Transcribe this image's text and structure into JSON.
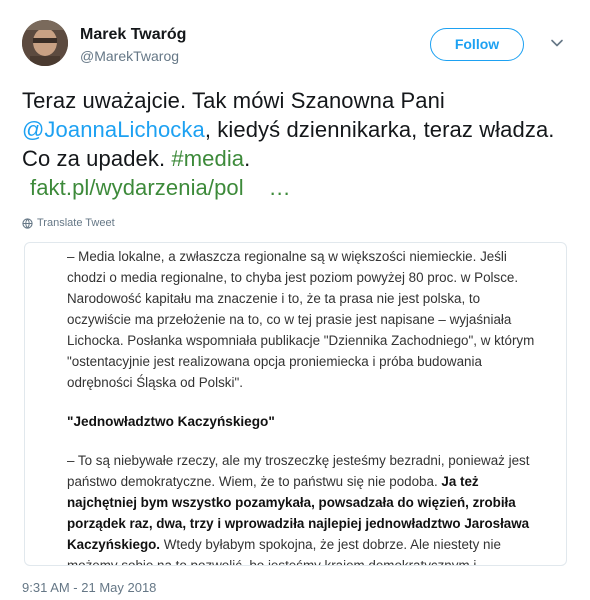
{
  "author": {
    "name": "Marek Twaróg",
    "handle": "@MarekTwarog"
  },
  "actions": {
    "follow_label": "Follow"
  },
  "tweet": {
    "text_part1": "Teraz uważajcie. Tak mówi Szanowna Pani",
    "mention": "@JoannaLichocka",
    "text_part2": ", kiedyś dziennikarka, teraz władza. Co za upadek. ",
    "hashtag": "#media",
    "text_part3": ".",
    "link": "fakt.pl/wydarzenia/pol",
    "ellipsis": "…"
  },
  "translate_label": "Translate Tweet",
  "card": {
    "paragraph1": "– Media lokalne, a zwłaszcza regionalne są w większości niemieckie. Jeśli chodzi o media regionalne, to chyba jest poziom powyżej 80 proc. w Polsce. Narodowość kapitału ma znaczenie i to, że ta prasa nie jest polska, to oczywiście ma przełożenie na to, co w tej prasie jest napisane – wyjaśniała Lichocka. Posłanka wspomniała publikacje \"Dziennika Zachodniego\", w którym \"ostentacyjnie jest realizowana opcja proniemiecka i próba budowania odrębności Śląska od Polski\".",
    "heading": "\"Jednowładztwo Kaczyńskiego\"",
    "paragraph2_start": "– To są niebywałe rzeczy, ale my troszeczkę jesteśmy bezradni, ponieważ jest państwo demokratyczne. Wiem, że to państwu się nie podoba. ",
    "paragraph2_bold": "Ja też najchętniej bym wszystko pozamykała, powsadzała do więzień, zrobiła porządek raz, dwa, trzy i wprowadziła najlepiej jednowładztwo Jarosława Kaczyńskiego.",
    "paragraph2_end": " Wtedy byłabym spokojna, że jest dobrze. Ale niestety nie możemy sobie na to pozwolić, bo jesteśmy krajem demokratycznym i obowiązują nas prawa i zasady"
  },
  "timestamp": "9:31 AM - 21 May 2018",
  "colors": {
    "accent": "#1da1f2",
    "link_green": "#3d8a3a",
    "secondary_text": "#657786"
  }
}
